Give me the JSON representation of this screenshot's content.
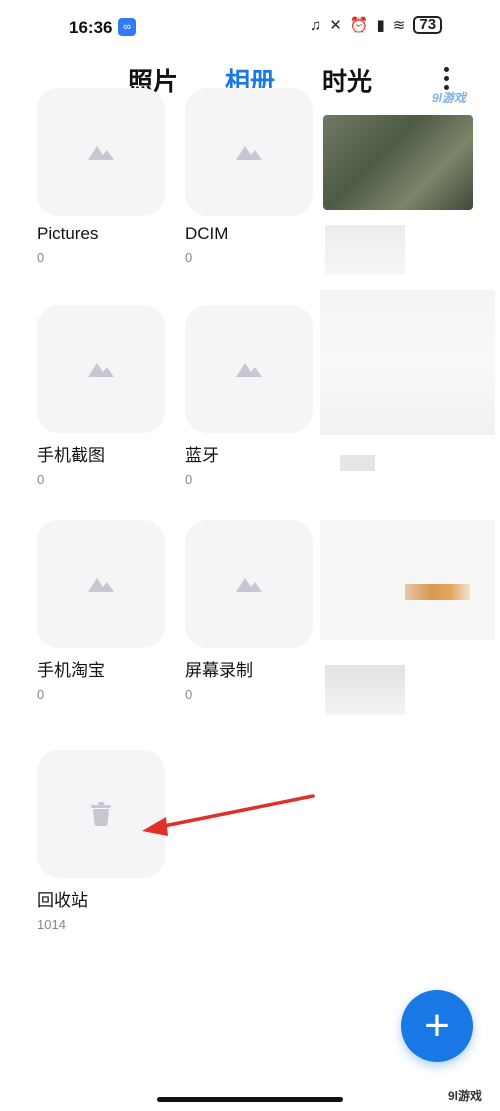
{
  "status_bar": {
    "time": "16:36",
    "battery": "73"
  },
  "tabs": [
    {
      "label": "照片"
    },
    {
      "label": "相册"
    },
    {
      "label": "时光"
    }
  ],
  "watermark_top": "9l游戏",
  "albums": [
    {
      "name": "Pictures",
      "count": "0"
    },
    {
      "name": "DCIM",
      "count": "0"
    },
    {
      "name": "手机截图",
      "count": "0"
    },
    {
      "name": "蓝牙",
      "count": "0"
    },
    {
      "name": "手机淘宝",
      "count": "0"
    },
    {
      "name": "屏幕录制",
      "count": "0"
    },
    {
      "name": "回收站",
      "count": "1014"
    }
  ],
  "fab": {
    "label": "+"
  },
  "watermark_bottom": "9l游戏",
  "colors": {
    "accent": "#1a77e6",
    "arrow": "#e0302a"
  }
}
